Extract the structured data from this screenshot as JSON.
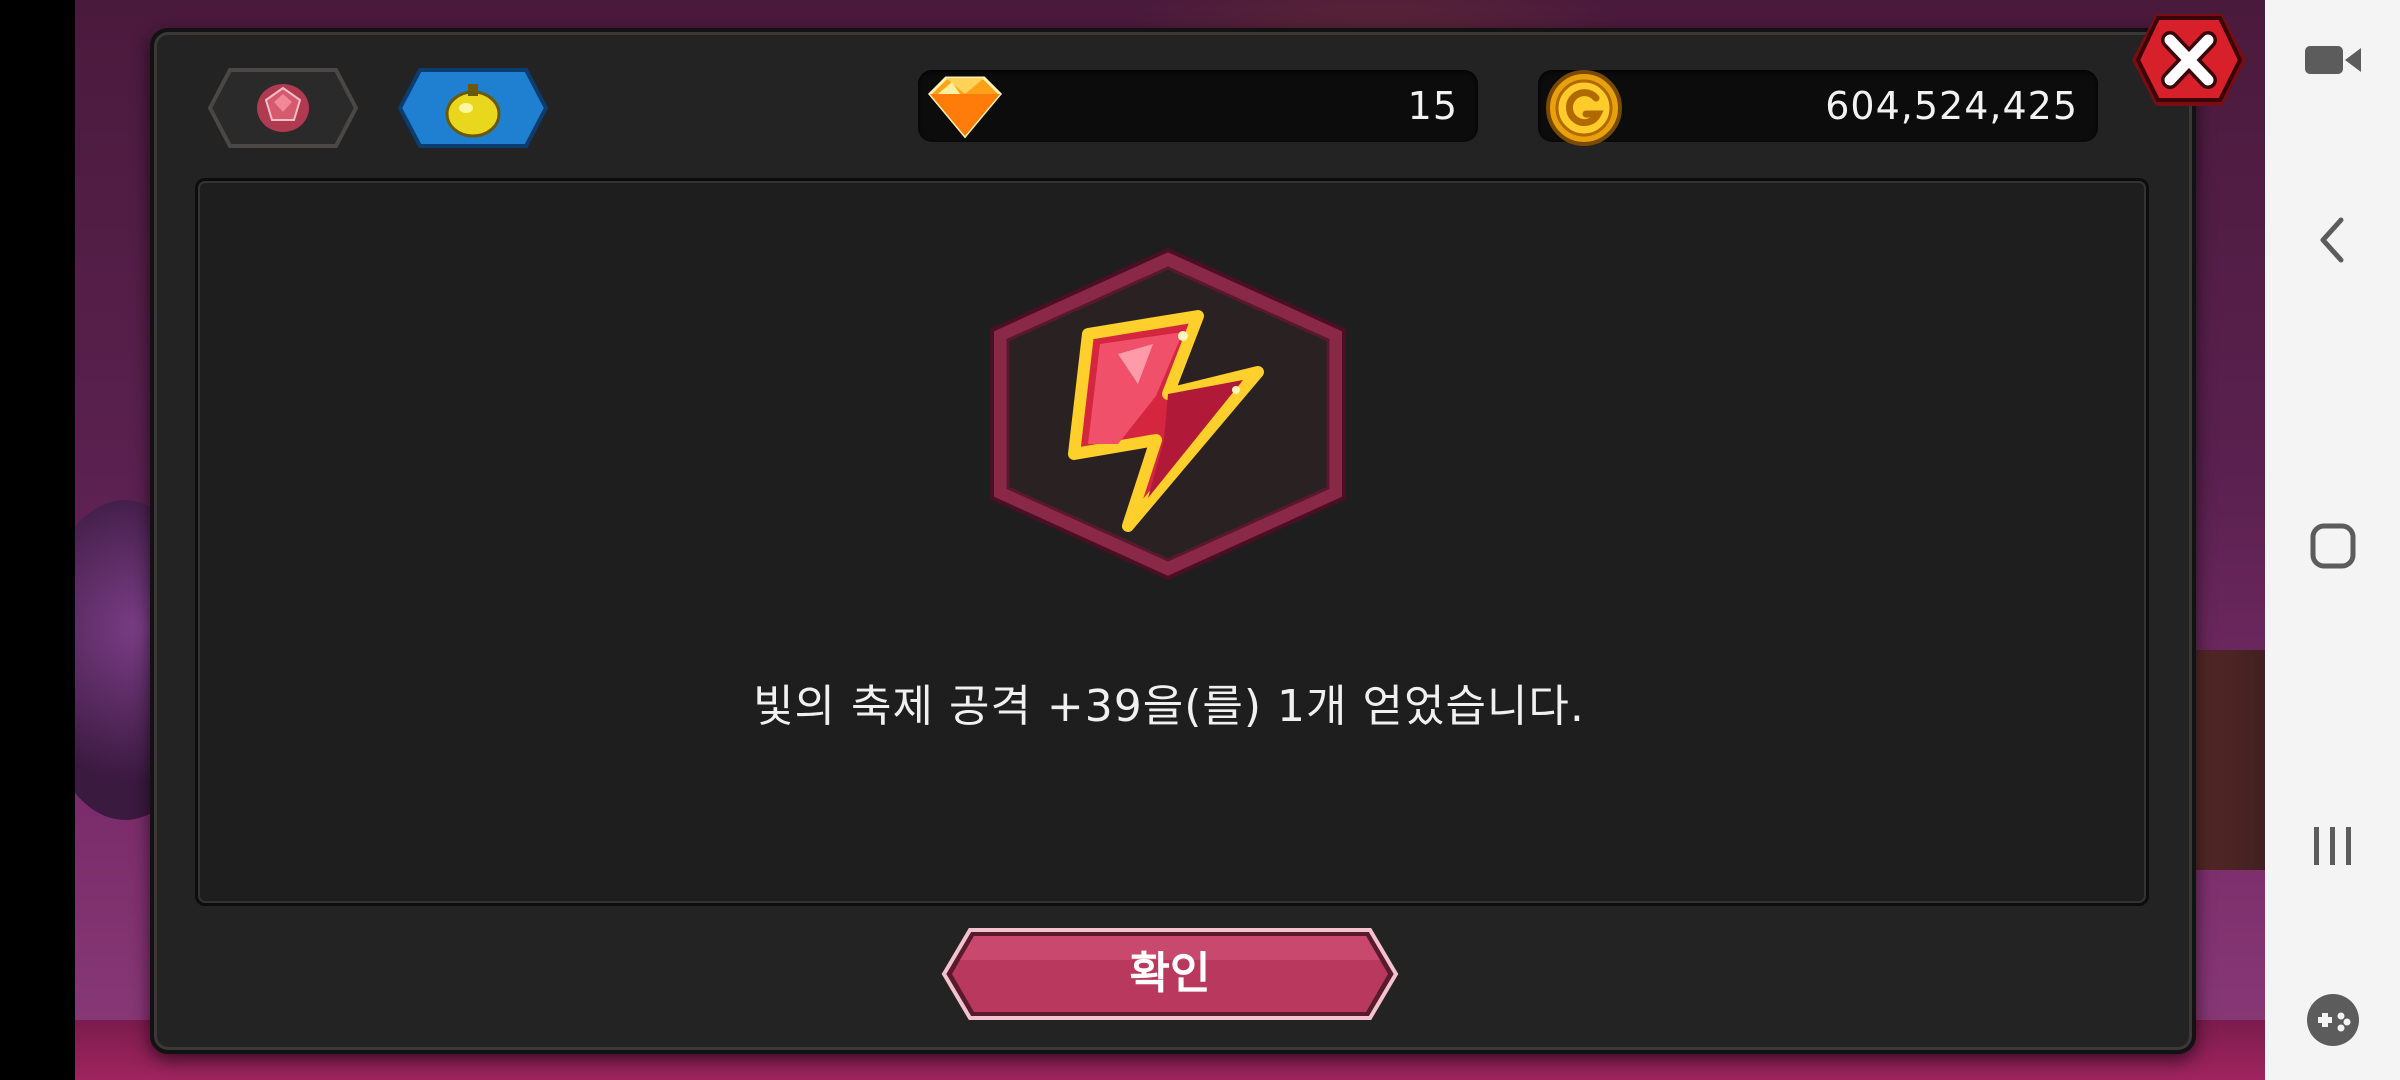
{
  "header": {
    "tabs": [
      {
        "icon": "gem-icon",
        "selected": false
      },
      {
        "icon": "yellow-potion-icon",
        "selected": true
      }
    ],
    "currencies": [
      {
        "icon": "diamond-icon",
        "value": "15"
      },
      {
        "icon": "gold-coin-icon",
        "value": "604,524,425"
      }
    ],
    "close_icon": "close-icon"
  },
  "reward": {
    "icon": "red-lightning-gem-icon",
    "message": "빛의 축제 공격 +39을(를) 1개 얻었습니다."
  },
  "confirm_button": {
    "label": "확인"
  },
  "navbar": {
    "items": [
      "video-camera-icon",
      "back-icon",
      "home-icon",
      "recent-apps-icon",
      "game-launcher-icon"
    ]
  },
  "colors": {
    "panel": "#242323",
    "content": "#1e1e1e",
    "accent_pink": "#b8385e",
    "hex_border": "#8a2848",
    "tab_blue": "#1f7fd0"
  }
}
